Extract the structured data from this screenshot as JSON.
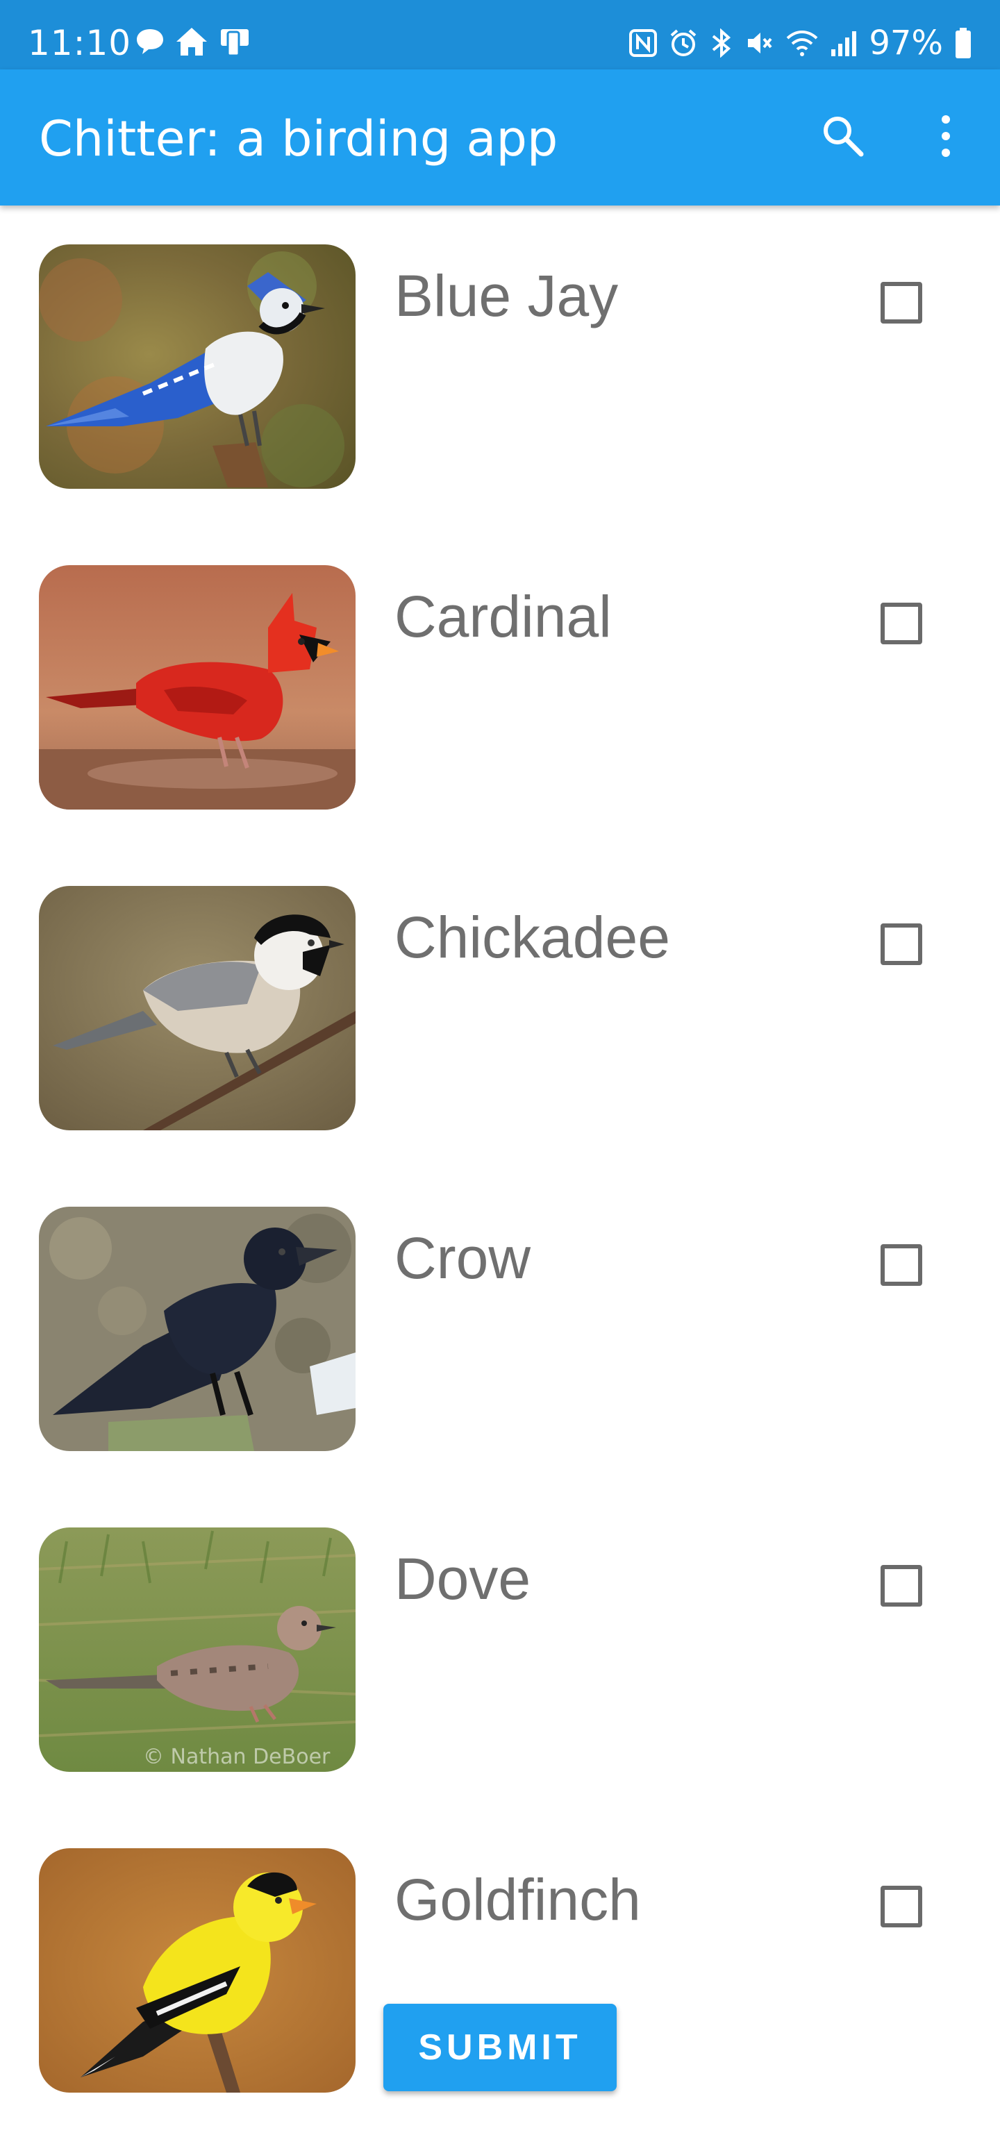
{
  "status_bar": {
    "time": "11:10",
    "battery": "97%",
    "left_icons": [
      "chat-bubble-icon",
      "home-icon",
      "device-icon"
    ],
    "right_icons": [
      "nfc-icon",
      "alarm-icon",
      "bluetooth-icon",
      "mute-icon",
      "wifi-icon",
      "signal-icon",
      "battery-icon"
    ]
  },
  "app_bar": {
    "title": "Chitter: a birding app",
    "actions": [
      "search-icon",
      "more-vert-icon"
    ]
  },
  "birds": [
    {
      "name": "Blue Jay",
      "checked": false
    },
    {
      "name": "Cardinal",
      "checked": false
    },
    {
      "name": "Chickadee",
      "checked": false
    },
    {
      "name": "Crow",
      "checked": false
    },
    {
      "name": "Dove",
      "checked": false
    },
    {
      "name": "Goldfinch",
      "checked": false
    }
  ],
  "photo_credit": "© Nathan DeBoer",
  "submit_label": "SUBMIT",
  "colors": {
    "status_bar": "#1d8ed8",
    "app_bar": "#20a0f0",
    "label_gray": "#6f6f6f",
    "button": "#20a0f0"
  }
}
